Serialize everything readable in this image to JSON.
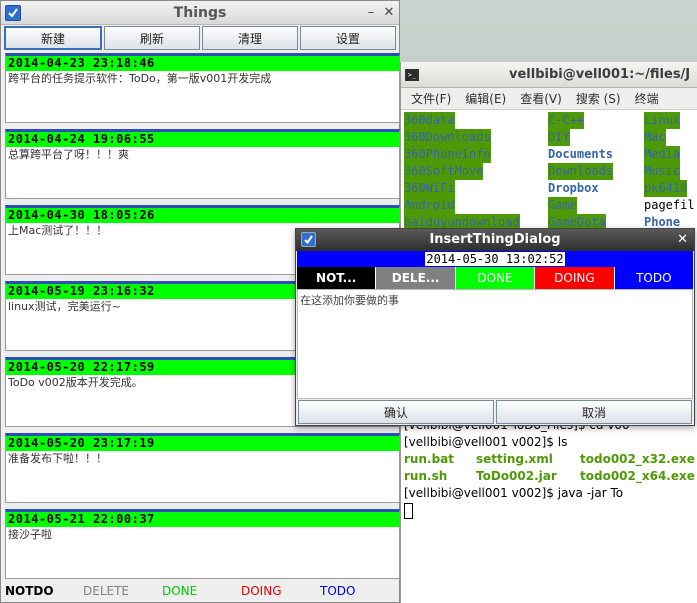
{
  "terminal": {
    "icon_label": ">_",
    "title": "vellbibi@vell001:~/files/J",
    "menu": [
      "文件(F)",
      "编辑(E)",
      "查看(V)",
      "搜索 (S)",
      "终端"
    ],
    "ls_rows": [
      [
        "360data",
        "C-C++",
        "Linux"
      ],
      [
        "360Downloads",
        "DIY",
        "Mac"
      ],
      [
        "360PhoneInfo",
        "Documents",
        "Media"
      ],
      [
        "360SoftMove",
        "Downloads",
        "Music"
      ],
      [
        "360WiFi",
        "Dropbox",
        "pk6410"
      ],
      [
        "Android",
        "Game",
        "pagefil"
      ],
      [
        "baiduyundownload",
        "GameData",
        "Phone"
      ]
    ],
    "lines": {
      "cd_cmd": "[vellbibi@vell001 ToDo_Files]$ cd v00",
      "ls_cmd": "[vellbibi@vell001 v002]$ ls",
      "files_row1": [
        "run.bat",
        "setting.xml",
        "todo002_x32.exe"
      ],
      "files_row2": [
        "run.sh",
        "ToDo002.jar",
        "todo002_x64.exe"
      ],
      "java_cmd": "[vellbibi@vell001 v002]$ java -jar To"
    }
  },
  "things": {
    "title": "Things",
    "toolbar": [
      "新建",
      "刷新",
      "清理",
      "设置"
    ],
    "items": [
      {
        "date": "2014-04-23 23:18:46",
        "text": "跨平台的任务提示软件：ToDo，第一版v001开发完成"
      },
      {
        "date": "2014-04-24 19:06:55",
        "text": "总算跨平台了呀！！！爽"
      },
      {
        "date": "2014-04-30 18:05:26",
        "text": "上Mac测试了！！！"
      },
      {
        "date": "2014-05-19 23:16:32",
        "text": "linux测试，完美运行~"
      },
      {
        "date": "2014-05-20 22:17:59",
        "text": "ToDo v002版本开发完成。"
      },
      {
        "date": "2014-05-20 23:17:19",
        "text": "准备发布下啦！！！"
      },
      {
        "date": "2014-05-21 22:00:37",
        "text": "接沙子啦"
      }
    ],
    "status": {
      "notdo": "NOTDO",
      "delete": "DELETE",
      "done": "DONE",
      "doing": "DOING",
      "todo": "TODO"
    }
  },
  "dialog": {
    "title": "InsertThingDialog",
    "date": "2014-05-30 13:02:52",
    "status": {
      "notdo": "NOT...",
      "delete": "DELE...",
      "done": "DONE",
      "doing": "DOING",
      "todo": "TODO"
    },
    "placeholder": "在这添加你要做的事",
    "ok": "确认",
    "cancel": "取消"
  },
  "colors": {
    "date_bg": "#00ff00",
    "card_border": "#2d4fb8",
    "done": "#00ff00",
    "doing": "#ff0000",
    "todo": "#0000ff",
    "delete": "#808080",
    "notdo": "#000000"
  }
}
